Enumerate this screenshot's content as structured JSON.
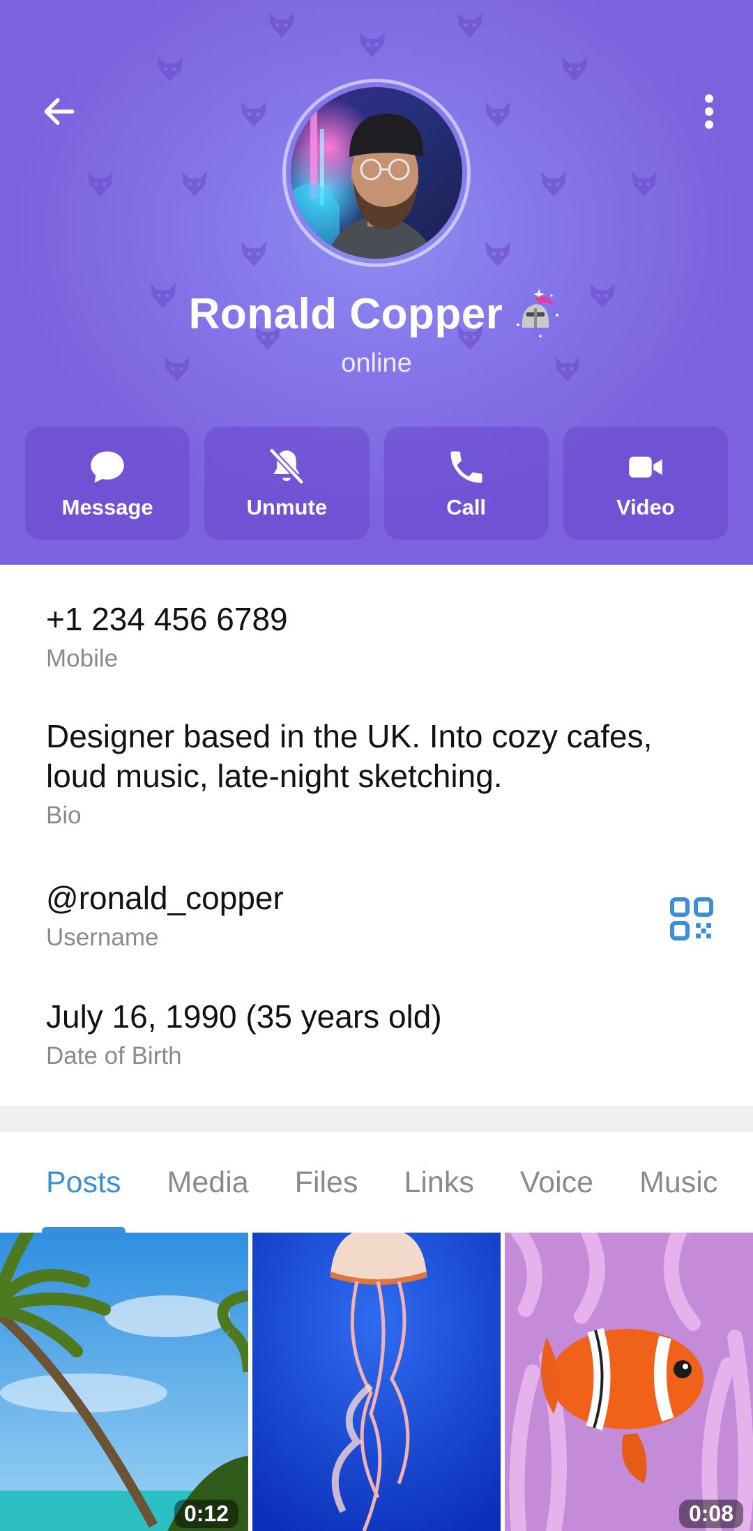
{
  "header": {
    "back_icon": "arrow-left-icon",
    "more_icon": "more-vertical-icon",
    "name": "Ronald Copper",
    "status": "online",
    "colors": {
      "bg_center": "#8f8cf0",
      "bg_edge": "#7d62dd",
      "button_bg": "#6a44cc"
    }
  },
  "actions": [
    {
      "label": "Message",
      "icon": "message-bubble-icon"
    },
    {
      "label": "Unmute",
      "icon": "bell-off-icon"
    },
    {
      "label": "Call",
      "icon": "phone-icon"
    },
    {
      "label": "Video",
      "icon": "video-camera-icon"
    }
  ],
  "info": {
    "phone": {
      "value": "+1 234 456 6789",
      "label": "Mobile"
    },
    "bio": {
      "value": "Designer based in the UK. Into cozy cafes, loud music, late-night sketching.",
      "label": "Bio"
    },
    "username": {
      "value": "@ronald_copper",
      "label": "Username",
      "icon": "qr-code-icon"
    },
    "birthday": {
      "value": "July 16, 1990 (35 years old)",
      "label": "Date of Birth"
    }
  },
  "tabs": [
    "Posts",
    "Media",
    "Files",
    "Links",
    "Voice",
    "Music"
  ],
  "active_tab": "Posts",
  "accent": "#3b8ed8",
  "media": [
    {
      "subject": "palm-tree-beach",
      "duration": "0:12"
    },
    {
      "subject": "jellyfish",
      "duration": ""
    },
    {
      "subject": "clownfish",
      "duration": "0:08"
    }
  ]
}
